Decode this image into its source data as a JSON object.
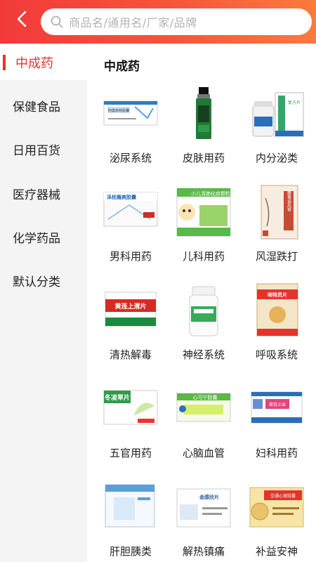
{
  "header": {
    "search_placeholder": "商品名/通用名/厂家/品牌",
    "back_icon": "chevron-left-icon",
    "search_icon": "search-icon"
  },
  "sidebar": {
    "items": [
      {
        "label": "中成药",
        "active": true
      },
      {
        "label": "保健食品",
        "active": false
      },
      {
        "label": "日用百货",
        "active": false
      },
      {
        "label": "医疗器械",
        "active": false
      },
      {
        "label": "化学药品",
        "active": false
      },
      {
        "label": "默认分类",
        "active": false
      }
    ]
  },
  "content": {
    "title": "中成药",
    "categories": [
      {
        "label": "泌尿系统",
        "box_text": "阿莫西林胶囊"
      },
      {
        "label": "皮肤用药",
        "box_text": ""
      },
      {
        "label": "内分泌类",
        "box_text": "复方片"
      },
      {
        "label": "男科用药",
        "box_text": "泽桂癃爽胶囊"
      },
      {
        "label": "儿科用药",
        "box_text": "小儿清肺化痰颗粒"
      },
      {
        "label": "风湿跌打",
        "box_text": "麝香追风膏"
      },
      {
        "label": "清热解毒",
        "box_text": "黄连上清片"
      },
      {
        "label": "神经系统",
        "box_text": ""
      },
      {
        "label": "呼吸系统",
        "box_text": "咳特灵片"
      },
      {
        "label": "五官用药",
        "box_text": "冬凌草片"
      },
      {
        "label": "心脑血管",
        "box_text": "心可宁胶囊"
      },
      {
        "label": "妇科用药",
        "box_text": "葆宫止血"
      },
      {
        "label": "肝胆胰类",
        "box_text": ""
      },
      {
        "label": "解热镇痛",
        "box_text": "金感欣片"
      },
      {
        "label": "补益安神",
        "box_text": "交通心肾胶囊"
      }
    ]
  },
  "colors": {
    "accent": "#e8312f",
    "header_start": "#f23a3a",
    "header_end": "#fb7a3c"
  }
}
